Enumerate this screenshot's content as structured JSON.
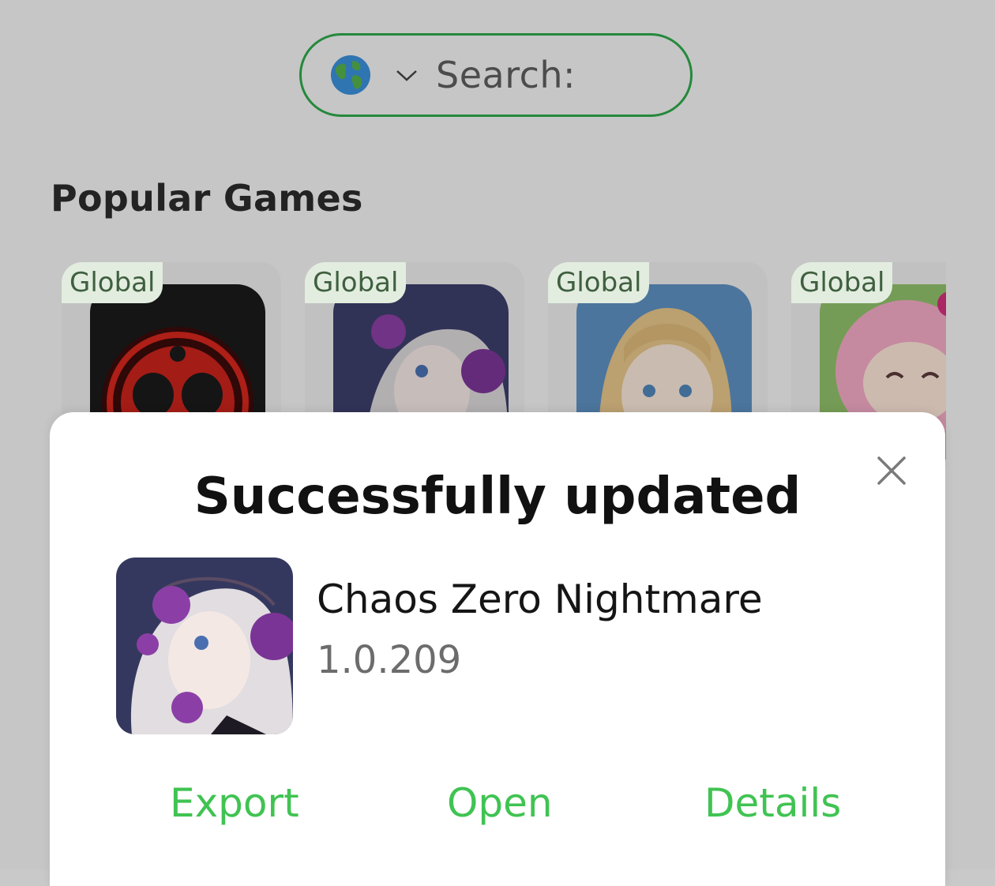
{
  "search": {
    "label": "Search:"
  },
  "popular": {
    "title": "Popular Games",
    "games": [
      {
        "region": "Global",
        "icon": "skull-game-icon"
      },
      {
        "region": "Global",
        "icon": "rose-anime-girl-icon"
      },
      {
        "region": "Global",
        "icon": "blonde-anime-girl-icon"
      },
      {
        "region": "Global",
        "icon": "pink-chibi-icon"
      }
    ]
  },
  "dialog": {
    "title": "Successfully updated",
    "app_name": "Chaos Zero Nightmare",
    "app_version": "1.0.209",
    "actions": {
      "export": "Export",
      "open": "Open",
      "details": "Details"
    }
  },
  "colors": {
    "accent_green": "#40c352",
    "search_border": "#2ea84a"
  }
}
